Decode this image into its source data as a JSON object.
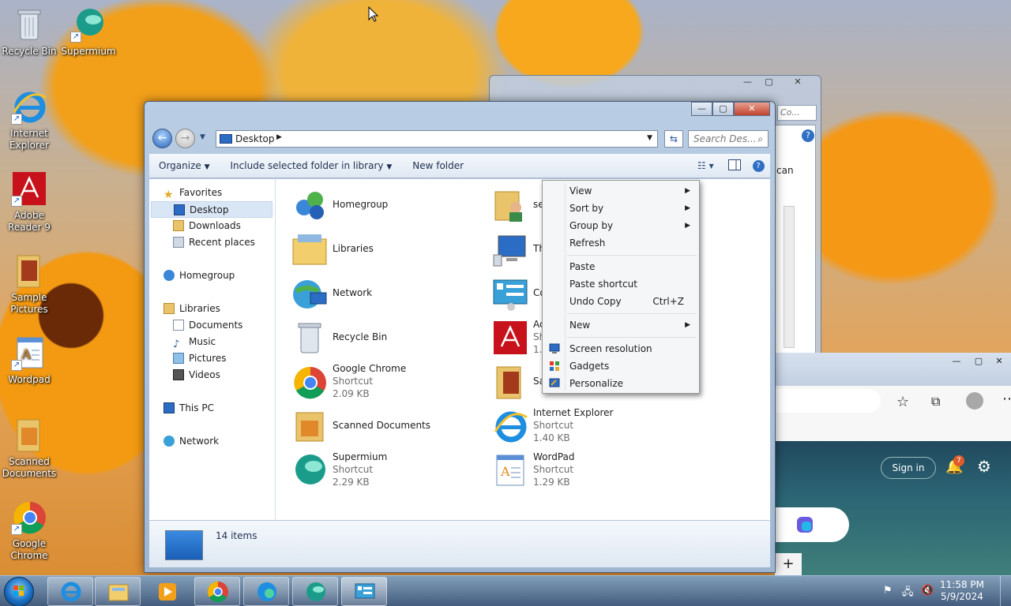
{
  "desktop": {
    "icons": [
      {
        "label": "Recycle Bin"
      },
      {
        "label": "Supermium"
      },
      {
        "label": "Internet Explorer"
      },
      {
        "label": "Adobe Reader 9"
      },
      {
        "label": "Sample Pictures"
      },
      {
        "label": "Wordpad"
      },
      {
        "label": "Scanned Documents"
      },
      {
        "label": "Google Chrome"
      }
    ]
  },
  "back_window": {
    "search_placeholder": "Co...",
    "snippet_text": "can"
  },
  "edge_window": {
    "sign_in_label": "Sign in",
    "notification_count": "7"
  },
  "explorer": {
    "address": "Desktop",
    "search_placeholder": "Search Des...",
    "toolbar": {
      "organize": "Organize",
      "include_in_library": "Include selected folder in library",
      "new_folder": "New folder"
    },
    "nav": {
      "favorites": "Favorites",
      "desktop": "Desktop",
      "downloads": "Downloads",
      "recent_places": "Recent places",
      "homegroup": "Homegroup",
      "libraries": "Libraries",
      "documents": "Documents",
      "music": "Music",
      "pictures": "Pictures",
      "videos": "Videos",
      "this_pc": "This PC",
      "network": "Network"
    },
    "items": [
      {
        "name": "Homegroup"
      },
      {
        "name": "Libraries"
      },
      {
        "name": "Network"
      },
      {
        "name": "Recycle Bin"
      },
      {
        "name": "Google Chrome",
        "type": "Shortcut",
        "size": "2.09 KB"
      },
      {
        "name": "Scanned Documents"
      },
      {
        "name": "Supermium",
        "type": "Shortcut",
        "size": "2.29 KB"
      },
      {
        "name": "se"
      },
      {
        "name": "Th"
      },
      {
        "name": "Co"
      },
      {
        "name": "Ac",
        "type": "Sh",
        "size": "1.9"
      },
      {
        "name": "Sa"
      },
      {
        "name": "Internet Explorer",
        "type": "Shortcut",
        "size": "1.40 KB"
      },
      {
        "name": "WordPad",
        "type": "Shortcut",
        "size": "1.29 KB"
      }
    ],
    "status": {
      "count": "14 items"
    }
  },
  "context_menu": {
    "view": "View",
    "sort_by": "Sort by",
    "group_by": "Group by",
    "refresh": "Refresh",
    "paste": "Paste",
    "paste_shortcut": "Paste shortcut",
    "undo_copy": "Undo Copy",
    "undo_copy_shortcut": "Ctrl+Z",
    "new": "New",
    "screen_resolution": "Screen resolution",
    "gadgets": "Gadgets",
    "personalize": "Personalize"
  },
  "taskbar": {
    "time": "11:58 PM",
    "date": "5/9/2024"
  }
}
